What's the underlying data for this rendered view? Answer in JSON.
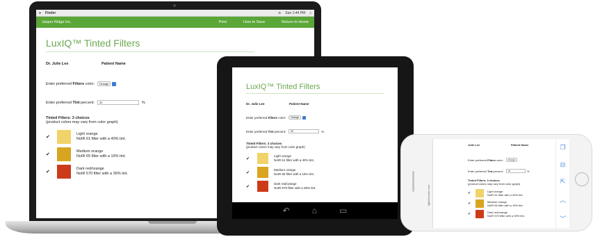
{
  "mac_menubar": {
    "app": "Finder",
    "clock": "Sun 1:44 PM"
  },
  "header": {
    "company": "Jasper Ridge Inc.",
    "nav": [
      "Print",
      "How to Save",
      "Return to Home"
    ]
  },
  "form": {
    "title": "LuxIQ™ Tinted Filters",
    "doctor": "Dr. Julie Lee",
    "doctor_short": "Julie Lee",
    "patient_label": "Patient Name",
    "color_prefix": "Enter preferred",
    "color_bold": "Filters",
    "color_suffix": "color:",
    "color_value": "Orange",
    "tint_prefix": "Enter preferred",
    "tint_bold": "Tint",
    "tint_suffix": "percent:",
    "tint_value": "30",
    "percent_sign": "%",
    "choices_heading": "Tinted Filters: 3 choices",
    "choices_note": "(product colors may vary from color graph)",
    "choices": [
      {
        "name": "Light orange",
        "desc": "NoIR 61 filter with a 40% tint.",
        "color": "#f0d36a",
        "checked": "✔"
      },
      {
        "name": "Medium orange",
        "desc": "NoIR 65 filter with a 15% tint.",
        "color": "#d9a520",
        "checked": "✔"
      },
      {
        "name": "Dark red/orange",
        "desc": "NoIR 570 filter with a 39% tint.",
        "color": "#cc3a1a",
        "checked": "✔"
      }
    ]
  },
  "phone": {
    "url": "lightchooser.com"
  },
  "colors": {
    "brand_green": "#5aa637",
    "title_green": "#6aa84f"
  },
  "icons": {
    "tablet_nav": [
      "back-icon",
      "home-icon",
      "recents-icon"
    ],
    "phone_side": [
      "copy-icon",
      "bookmark-icon",
      "share-icon",
      "chevron-up-icon",
      "chevron-down-icon"
    ]
  }
}
